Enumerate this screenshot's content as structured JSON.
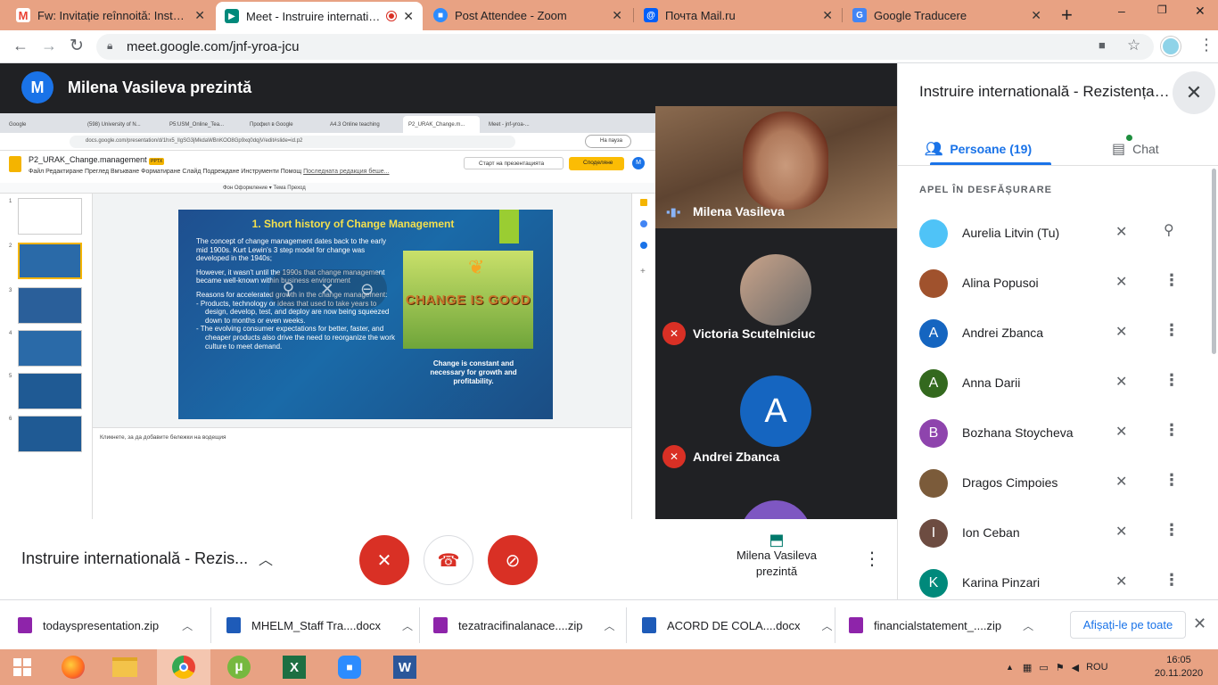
{
  "browser": {
    "tabs": [
      {
        "title": "Fw: Invitație reînnoită: Instruire i",
        "favicon": "gmail-icon",
        "color": "#ea4335"
      },
      {
        "title": "Meet - Instruire internationa",
        "favicon": "meet-icon",
        "color": "#00897b"
      },
      {
        "title": "Post Attendee - Zoom",
        "favicon": "zoom-icon",
        "color": "#2d8cff"
      },
      {
        "title": "Почта Mail.ru",
        "favicon": "mailru-icon",
        "color": "#005ff9"
      },
      {
        "title": "Google Traducere",
        "favicon": "translate-icon",
        "color": "#4285f4"
      }
    ],
    "url": "meet.google.com/jnf-yroa-jcu",
    "window_controls": [
      "–",
      "❐",
      "✕"
    ]
  },
  "meet": {
    "presenter_initial": "M",
    "presenter_label": "Milena Vasileva prezintă",
    "tiles": [
      {
        "name": "Milena Vasileva"
      },
      {
        "name": "Victoria Scutelniciuc"
      },
      {
        "name": "Andrei Zbanca",
        "initial": "A"
      }
    ],
    "meeting_name": "Instruire internatională - Rezis...",
    "presenting_label": "Milena Vasileva prezintă"
  },
  "shared_screen": {
    "tabs": [
      "Google",
      "(598) University of N...",
      "P5:USM_Online_Tea...",
      "Профил в Google",
      "A4.3 Online teaching",
      "P2_URAK_Change.m...",
      "Meet - jnf-yroa-..."
    ],
    "url": "docs.google.com/presentation/d/1hx5_llgSG3jMkdaWBnKOO8Gp9xq0dqjV/edit#slide=id.p2",
    "pause_label": "На пауза",
    "doc_title": "P2_URAK_Change.management",
    "doc_badge": "PPTX",
    "menu": "Файл   Редактиране   Преглед   Вмъкване   Форматиране   Слайд   Подреждане   Инструменти   Помощ",
    "last_edit": "Последната редакция беше...",
    "present_btn": "Старт на презентацията",
    "share_btn": "Споделяне",
    "account_initial": "M",
    "toolbar_text": "Фон     Оформление ▾     Тема     Преход",
    "slide_numbers": [
      "1",
      "2",
      "3",
      "4",
      "5",
      "6"
    ],
    "notes_placeholder": "Кликнете, за да добавите бележки на водещия",
    "slide": {
      "title": "1. Short history of Change Management",
      "paragraphs": [
        "The concept of change management dates back to the early mid 1900s. Kurt Lewin's 3 step model for change was developed in the 1940s;",
        "However, it wasn't until the 1990s that change management became well-known within business environment",
        "Reasons for accelerated growth in the change management:"
      ],
      "bullets": [
        "Products, technology or ideas that used to take years to design, develop, test, and deploy are now being squeezed down to months or even weeks.",
        "The evolving consumer expectations for better, faster, and cheaper products also drive the need to reorganize the work culture to meet demand."
      ],
      "image_text": "CHANGE IS GOOD",
      "caption": "Change is constant and necessary for growth and profitability."
    }
  },
  "panel": {
    "title": "Instruire internatională - Rezistența la schimbare",
    "tab_people": "Persoane (19)",
    "tab_chat": "Chat",
    "section_label": "APEL ÎN DESFĂȘURARE",
    "participants": [
      {
        "name": "Aurelia Litvin (Tu)",
        "initial": "",
        "color": "#4fc3f7",
        "photo": true
      },
      {
        "name": "Alina Popusoi",
        "initial": "",
        "color": "#a0522d",
        "photo": true
      },
      {
        "name": "Andrei Zbanca",
        "initial": "A",
        "color": "#1565c0",
        "photo": false
      },
      {
        "name": "Anna Darii",
        "initial": "A",
        "color": "#33691e",
        "photo": false
      },
      {
        "name": "Bozhana Stoycheva",
        "initial": "B",
        "color": "#8e44ad",
        "photo": false
      },
      {
        "name": "Dragos Cimpoies",
        "initial": "",
        "color": "#7b5b3a",
        "photo": true
      },
      {
        "name": "Ion Ceban",
        "initial": "I",
        "color": "#6d4c41",
        "photo": false
      },
      {
        "name": "Karina Pinzari",
        "initial": "K",
        "color": "#00897b",
        "photo": false
      }
    ]
  },
  "downloads": {
    "items": [
      {
        "name": "todayspresentation.zip",
        "icon_color": "#8e24aa"
      },
      {
        "name": "MHELM_Staff Tra....docx",
        "icon_color": "#1e5bb8"
      },
      {
        "name": "tezatracifinalanace....zip",
        "icon_color": "#8e24aa"
      },
      {
        "name": "ACORD DE COLA....docx",
        "icon_color": "#1e5bb8"
      },
      {
        "name": "financialstatement_....zip",
        "icon_color": "#8e24aa"
      }
    ],
    "show_all": "Afișați-le pe toate"
  },
  "taskbar": {
    "apps": [
      "start-icon",
      "firefox-icon",
      "file-explorer-icon",
      "chrome-icon",
      "utorrent-icon",
      "excel-icon",
      "zoom-icon",
      "word-icon"
    ],
    "language": "ROU",
    "time": "16:05",
    "date": "20.11.2020"
  }
}
